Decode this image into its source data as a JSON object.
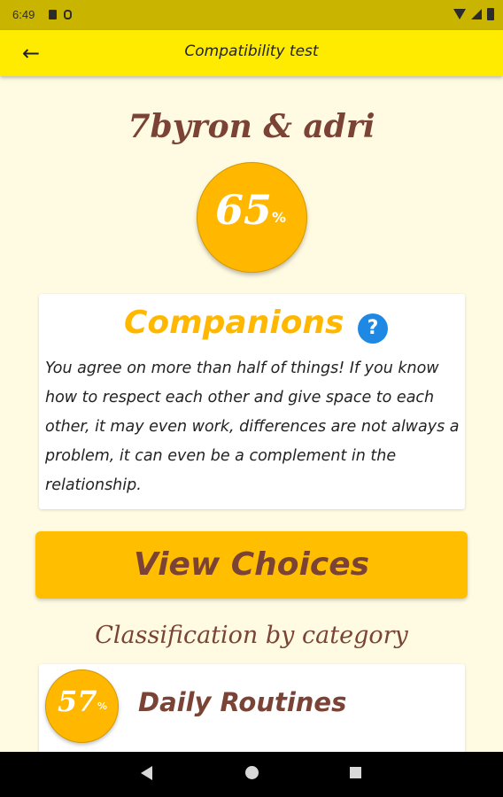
{
  "status_bar": {
    "time": "6:49",
    "left_icons": [
      "sim-card-icon",
      "storage-icon"
    ],
    "right_icons": [
      "wifi-icon",
      "signal-icon",
      "battery-icon"
    ]
  },
  "app_bar": {
    "back_icon": "arrow-left-icon",
    "title": "Compatibility test",
    "color": "#ffeb00"
  },
  "result": {
    "names": "7byron & adri",
    "percent": "65",
    "percent_sign": "%"
  },
  "verdict": {
    "title": "Companions",
    "help_icon": "question-icon",
    "help_label": "?",
    "description": " You agree on more than half of things! If you know how to respect each other and give space to each other, it may even work, differences are not always a problem, it can even be a complement in the relationship."
  },
  "actions": {
    "view_choices_label": "View Choices"
  },
  "classification": {
    "title": "Classification by category",
    "categories": [
      {
        "name": "Daily Routines",
        "percent": "57",
        "percent_sign": "%"
      }
    ]
  },
  "nav_bar": {
    "icons": [
      "nav-back-icon",
      "nav-home-icon",
      "nav-recents-icon"
    ]
  },
  "colors": {
    "accent": "#ffb700",
    "text_brown": "#7a4335",
    "background": "#fffbe3",
    "help_blue": "#1e88e5"
  }
}
